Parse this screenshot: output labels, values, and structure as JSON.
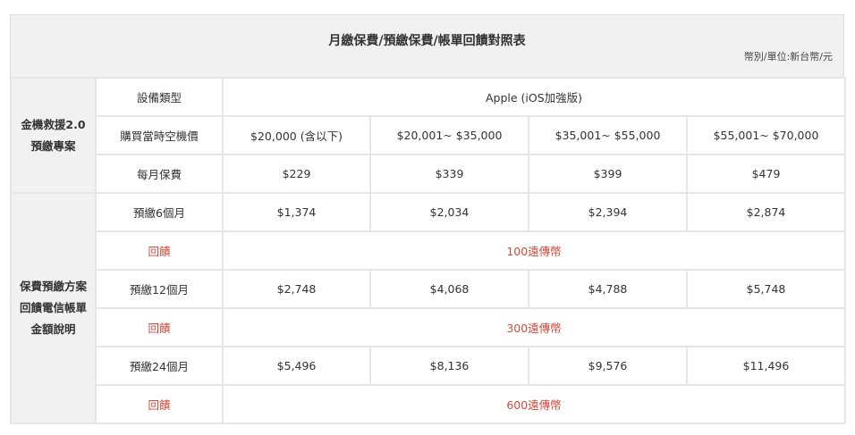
{
  "title": "月繳保費/預繳保費/帳單回饋對照表",
  "unit_note": "幣別/單位:新台幣/元",
  "section1": {
    "label_line1": "金機救援2.0",
    "label_line2": "預繳專案",
    "device_label": "設備類型",
    "device_value": "Apple (iOS加強版)",
    "price_label": "購買當時空機價",
    "price_tiers": [
      "$20,000 (含以下)",
      "$20,001~ $35,000",
      "$35,001~ $55,000",
      "$55,001~ $70,000"
    ],
    "monthly_label": "每月保費",
    "monthly_values": [
      "$229",
      "$339",
      "$399",
      "$479"
    ]
  },
  "section2": {
    "label_line1": "保費預繳方案",
    "label_line2": "回饋電信帳單",
    "label_line3": "金額說明",
    "plans": [
      {
        "label": "預繳6個月",
        "values": [
          "$1,374",
          "$2,034",
          "$2,394",
          "$2,874"
        ],
        "reward_label": "回饋",
        "reward_value": "100遠傳幣"
      },
      {
        "label": "預繳12個月",
        "values": [
          "$2,748",
          "$4,068",
          "$4,788",
          "$5,748"
        ],
        "reward_label": "回饋",
        "reward_value": "300遠傳幣"
      },
      {
        "label": "預繳24個月",
        "values": [
          "$5,496",
          "$8,136",
          "$9,576",
          "$11,496"
        ],
        "reward_label": "回饋",
        "reward_value": "600遠傳幣"
      }
    ]
  },
  "colors": {
    "reward_text": "#d04a3a",
    "header_bg": "#f1f1f1",
    "border": "#e6e6e6"
  }
}
